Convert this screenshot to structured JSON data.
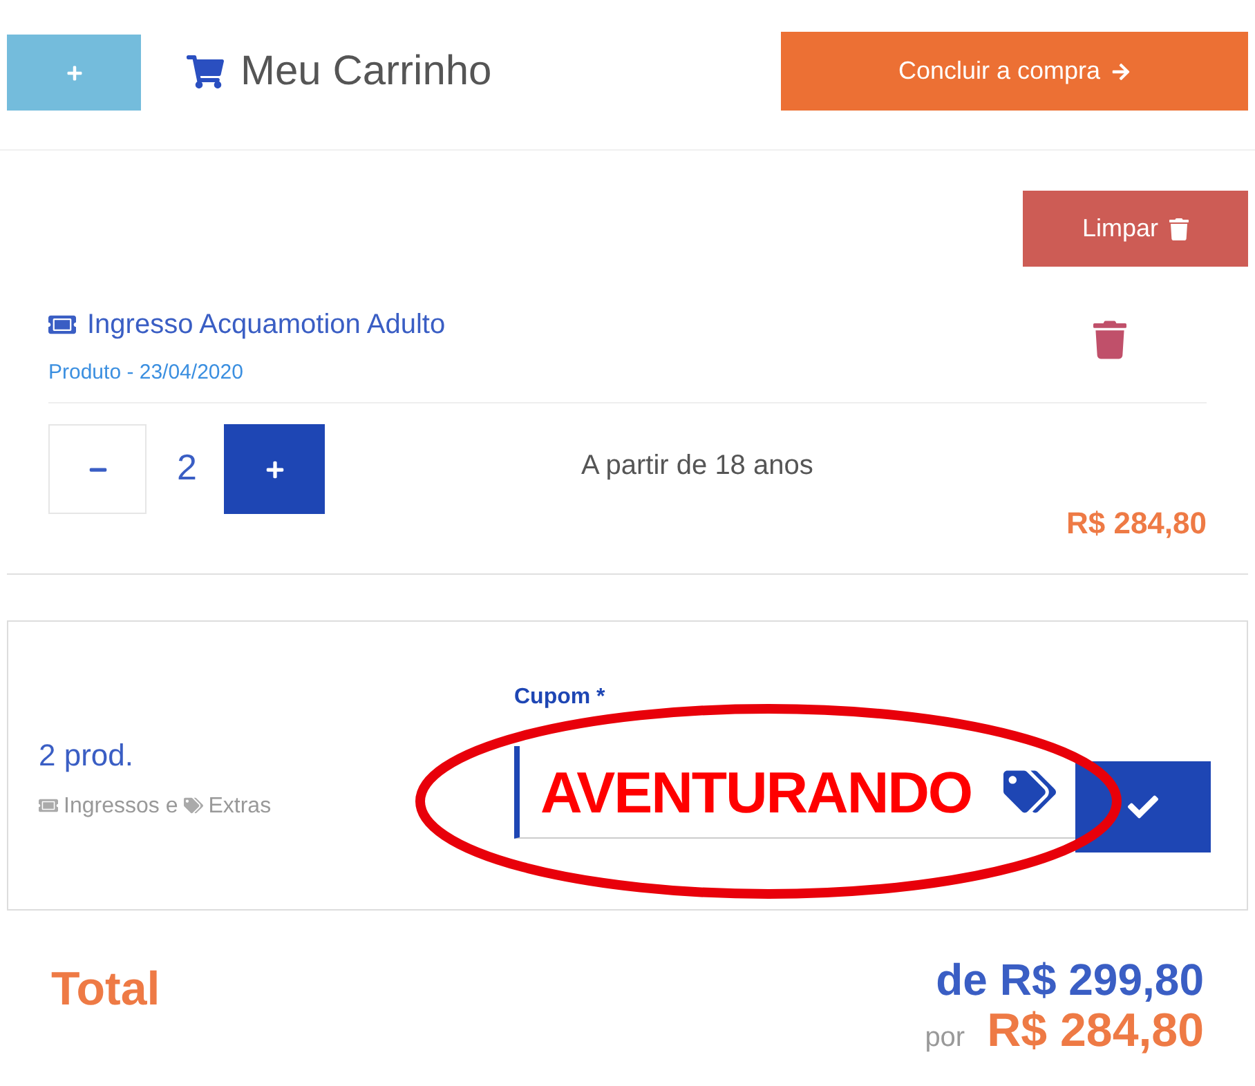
{
  "header": {
    "title": "Meu Carrinho",
    "checkout_button": "Concluir a compra"
  },
  "clear_button": "Limpar",
  "cart_items": [
    {
      "name": "Ingresso Acquamotion Adulto",
      "subtitle": "Produto - 23/04/2020",
      "quantity": "2",
      "description": "A partir de 18 anos",
      "price": "R$ 284,80"
    }
  ],
  "summary": {
    "count": "2 prod.",
    "categories": [
      {
        "kind": "ticket",
        "label": "Ingressos e"
      },
      {
        "kind": "tags",
        "label": "Extras"
      }
    ],
    "coupon": {
      "label": "Cupom *",
      "value": "AVENTURANDO"
    }
  },
  "total": {
    "label": "Total",
    "original_price": "de R$ 299,80",
    "price_prefix": "por",
    "price": "R$ 284,80"
  }
}
